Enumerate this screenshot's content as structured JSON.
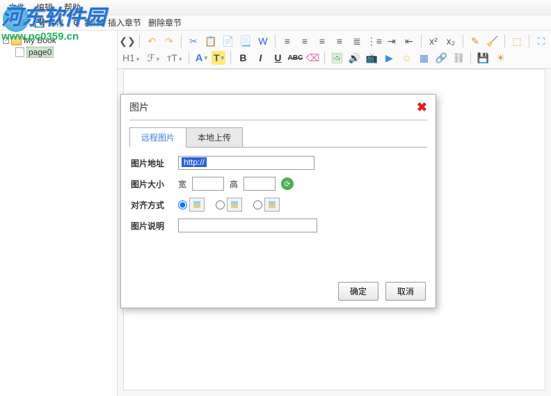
{
  "menu": {
    "file": "文件",
    "edit": "编辑",
    "help": "帮助"
  },
  "toolbar": {
    "new": "新",
    "save": "保存",
    "make": "制作",
    "insertChapter": "插入章节",
    "deleteChapter": "删除章节"
  },
  "tree": {
    "root": "My Book",
    "page": "page0"
  },
  "watermark": {
    "name": "河东软件园",
    "url": "www.pc0359.cn"
  },
  "editor": {
    "h1": "H1",
    "fontF": "ℱ",
    "tT": "⁠ᴛT",
    "A": "A",
    "T": "T",
    "B": "B",
    "I": "I",
    "U": "U",
    "ABC": "ABC",
    "sup": "x²",
    "sub": "x₂"
  },
  "dialog": {
    "title": "图片",
    "tabs": {
      "remote": "远程图片",
      "local": "本地上传"
    },
    "urlLabel": "图片地址",
    "urlValue": "http://",
    "sizeLabel": "图片大小",
    "w": "宽",
    "h": "高",
    "alignLabel": "对齐方式",
    "descLabel": "图片说明",
    "ok": "确定",
    "cancel": "取消"
  }
}
